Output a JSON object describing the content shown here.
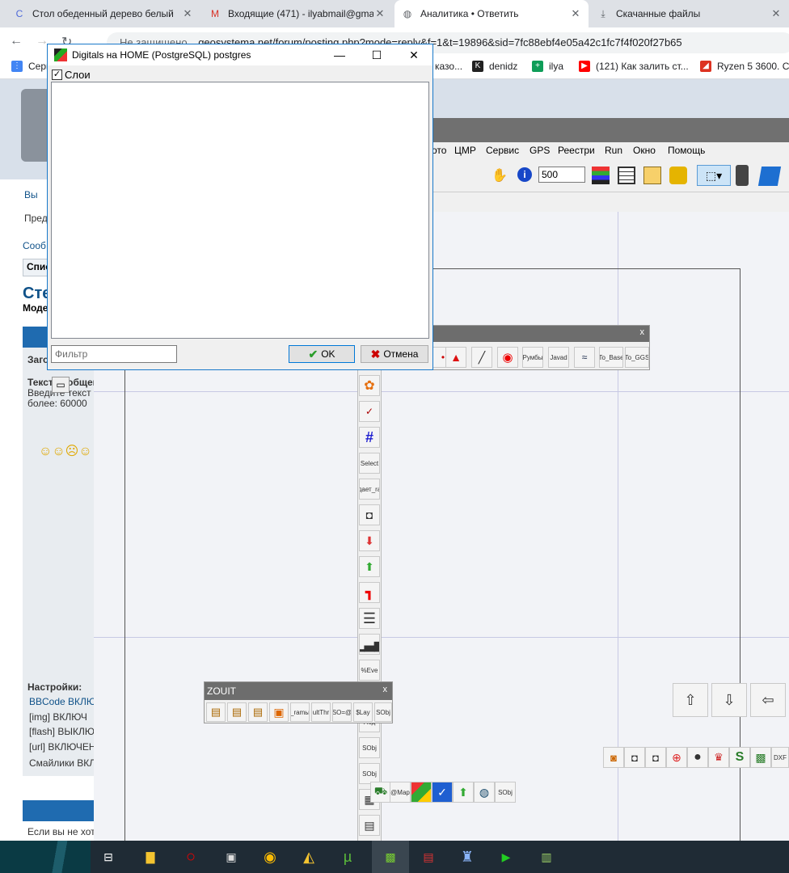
{
  "tabs": [
    {
      "title": "Стол обеденный дерево белый",
      "active": false
    },
    {
      "title": "Входящие (471) - ilyabmail@gmail",
      "active": false
    },
    {
      "title": "Аналитика • Ответить",
      "active": true
    },
    {
      "title": "Скачанные файлы",
      "active": false
    }
  ],
  "address": {
    "security": "Не защищено",
    "url": "geosystema.net/forum/posting.php?mode=reply&f=1&t=19896&sid=7fc88ebf4e05a42c1fc7f4f020f27b65"
  },
  "bookmarks": [
    "Серв",
    "казо...",
    "denidz",
    "ilya",
    "(121) Как залить ст...",
    "Ryzen 5 3600. C"
  ],
  "forum": {
    "lines": [
      "Вы",
      "Пред",
      "Сооб",
      "Спис",
      "Сте",
      "Моде",
      "Загол",
      "Текст сообщения",
      "Введите текст",
      "более: 60000",
      "Настройки:",
      "BBCode ВКЛЮЧ",
      "[img] ВКЛЮЧ",
      "[flash] ВЫКЛЮ",
      "[url] ВКЛЮЧЕН",
      "Смайлики ВКЛ",
      "Если вы не хот"
    ]
  },
  "app": {
    "menu": [
      "ото",
      "ЦМР",
      "Сервис",
      "GPS",
      "Реестри",
      "Run",
      "Окно",
      "Помощь"
    ],
    "scale_value": "500",
    "float_toolbar": {
      "close": "x",
      "buttons": [
        "Румбы",
        "Javad",
        "To_Base",
        "To_GGS"
      ]
    },
    "vertical_tools": [
      "Select",
      "дает_ra",
      "%Eve",
      "Под",
      "SObj",
      "SObj"
    ],
    "bottom_tools": [
      "@Map",
      "SObj"
    ],
    "right_tools": [
      "DXF"
    ]
  },
  "zouit": {
    "title": "ZOUIT",
    "close": "x",
    "buttons": [
      "_ramы",
      "ultThr",
      "SO=@",
      "$Lay",
      "SObj"
    ]
  },
  "dialog": {
    "title": "Digitals на HOME (PostgreSQL) postgres",
    "layers_label": "Слои",
    "filter_placeholder": "Фильтр",
    "ok": "OK",
    "cancel": "Отмена"
  }
}
